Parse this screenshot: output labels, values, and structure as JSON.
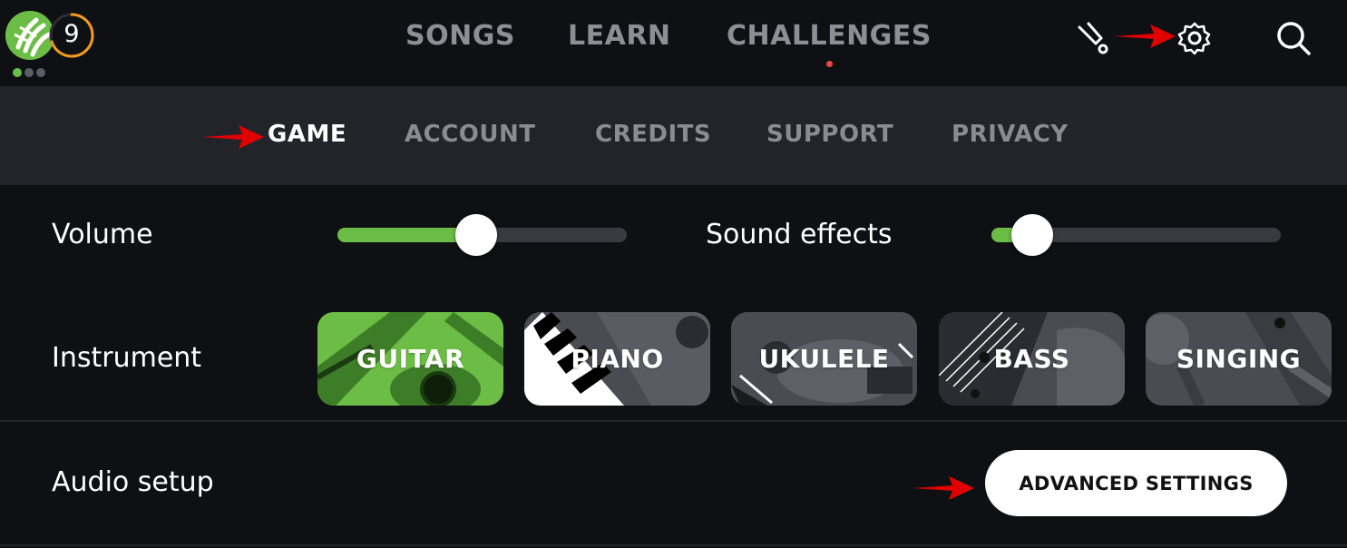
{
  "header": {
    "level": "9",
    "progress_dots_total": 3,
    "progress_dots_filled": 1,
    "level_progress_fraction": 0.7,
    "nav": [
      {
        "label": "SONGS"
      },
      {
        "label": "LEARN"
      },
      {
        "label": "CHALLENGES"
      }
    ],
    "icons": [
      "tuner-icon",
      "gear-icon",
      "search-icon"
    ]
  },
  "settings_tabs": [
    {
      "label": "GAME",
      "active": true
    },
    {
      "label": "ACCOUNT"
    },
    {
      "label": "CREDITS"
    },
    {
      "label": "SUPPORT"
    },
    {
      "label": "PRIVACY"
    }
  ],
  "game": {
    "volume": {
      "label": "Volume",
      "value_fraction": 0.48
    },
    "sound_effects": {
      "label": "Sound effects",
      "value_fraction": 0.14
    },
    "instrument": {
      "label": "Instrument",
      "options": [
        {
          "label": "GUITAR",
          "selected": true
        },
        {
          "label": "PIANO"
        },
        {
          "label": "UKULELE"
        },
        {
          "label": "BASS"
        },
        {
          "label": "SINGING"
        }
      ]
    },
    "audio_setup": {
      "label": "Audio setup",
      "button": "ADVANCED SETTINGS"
    }
  },
  "colors": {
    "accent_green": "#6cbd45",
    "level_ring": "#f39a1e",
    "notification_dot": "#e74655",
    "annotation_arrow": "#e00000",
    "background": "#0f1014",
    "subbar": "#22242a"
  }
}
